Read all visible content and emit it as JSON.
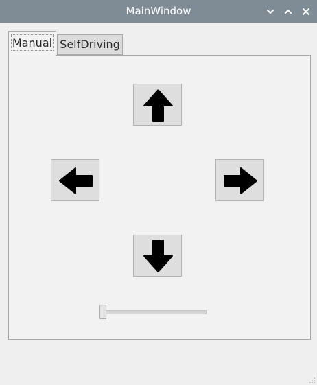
{
  "window": {
    "title": "MainWindow",
    "controls": [
      "minimize-icon",
      "maximize-icon",
      "close-icon"
    ]
  },
  "tabs": [
    {
      "label": "Manual",
      "selected": true
    },
    {
      "label": "SelfDriving",
      "selected": false
    }
  ],
  "manual_controls": {
    "buttons": [
      "up-arrow-icon",
      "left-arrow-icon",
      "right-arrow-icon",
      "down-arrow-icon"
    ],
    "slider_value": 0
  },
  "colors": {
    "titlebar": "#7f8c95",
    "window_bg": "#efefef",
    "button_bg": "#dedede"
  }
}
